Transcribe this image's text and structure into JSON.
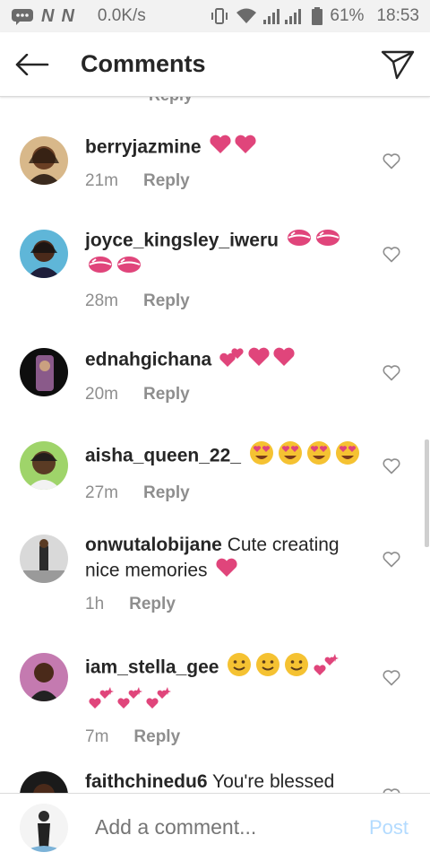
{
  "status_bar": {
    "speed": "0.0K/s",
    "battery": "61%",
    "time": "18:53",
    "carrier_glyph": "N"
  },
  "header": {
    "title": "Comments",
    "back_icon": "arrow-left-icon",
    "share_icon": "paper-plane-icon"
  },
  "comments": [
    {
      "username": "berryjazmine",
      "text": "",
      "time": "21m",
      "reply": "Reply",
      "emojis": [
        "heart",
        "heart"
      ],
      "emojis2": []
    },
    {
      "username": "joyce_kingsley_iweru",
      "text": "",
      "time": "28m",
      "reply": "Reply",
      "emojis": [
        "kiss",
        "kiss"
      ],
      "emojis2": [
        "kiss",
        "kiss"
      ]
    },
    {
      "username": "ednahgichana",
      "text": "",
      "time": "20m",
      "reply": "Reply",
      "emojis": [
        "two-hearts",
        "heart",
        "heart"
      ],
      "emojis2": []
    },
    {
      "username": "aisha_queen_22_",
      "text": "",
      "time": "27m",
      "reply": "Reply",
      "emojis": [
        "heart-eyes",
        "heart-eyes",
        "heart-eyes",
        "heart-eyes"
      ],
      "emojis2": []
    },
    {
      "username": "onwutalobijane",
      "text": "Cute creating nice memories",
      "time": "1h",
      "reply": "Reply",
      "emojis": [
        "heart"
      ],
      "emojis2": []
    },
    {
      "username": "iam_stella_gee",
      "text": "",
      "time": "7m",
      "reply": "Reply",
      "emojis": [
        "smile",
        "smile",
        "smile",
        "sparkle"
      ],
      "emojis2": [
        "sparkle",
        "sparkle",
        "sparkle"
      ]
    },
    {
      "username": "faithchinedu6",
      "text": "You're blessed",
      "time": "",
      "reply": "",
      "emojis": [],
      "emojis2": []
    }
  ],
  "composer": {
    "placeholder": "Add a comment...",
    "post_label": "Post"
  },
  "colors": {
    "heart": "#e0457b",
    "post_disabled": "#b3dbff",
    "meta_gray": "#8e8e8e"
  }
}
